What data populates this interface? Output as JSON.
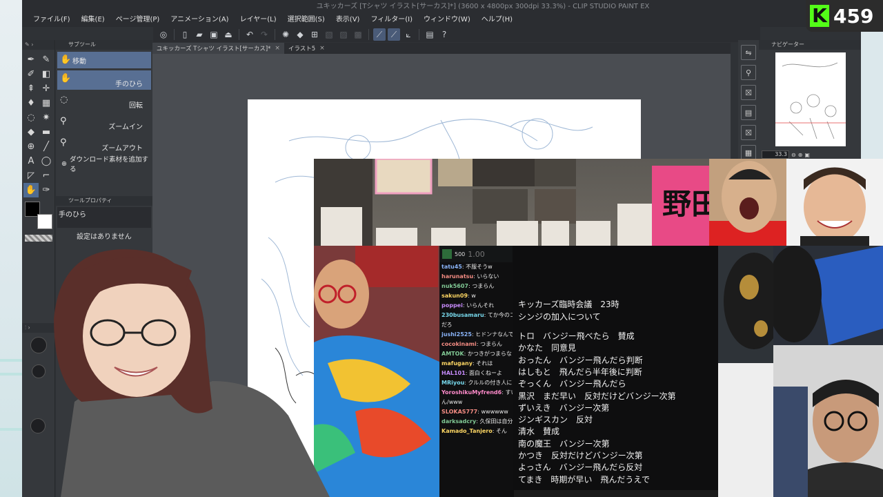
{
  "window": {
    "title": "ユキッカーズ [Tシャツ イラスト[サーカス]*] (3600 x 4800px 300dpi 33.3%) - CLIP STUDIO PAINT EX"
  },
  "menu": [
    "ファイル(F)",
    "編集(E)",
    "ページ管理(P)",
    "アニメーション(A)",
    "レイヤー(L)",
    "選択範囲(S)",
    "表示(V)",
    "フィルター(I)",
    "ウィンドウ(W)",
    "ヘルプ(H)"
  ],
  "subtool_panel": {
    "header": "サブツール",
    "items": [
      {
        "label": "移動",
        "position": "left",
        "selected": true
      },
      {
        "label": "手のひら",
        "position": "right",
        "selected": true
      },
      {
        "label": "回転",
        "position": "right"
      },
      {
        "label": "ズームイン",
        "position": "right"
      },
      {
        "label": "ズームアウト",
        "position": "right"
      }
    ],
    "add_material": "ダウンロード素材を追加する"
  },
  "tool_property": {
    "header": "ツールプロパティ",
    "tool_name": "手のひら",
    "no_settings": "設定はありません"
  },
  "doc_tabs": [
    {
      "label": "ユキッカーズ Tシャツ イラスト[サーカス]*",
      "active": true
    },
    {
      "label": "イラスト5",
      "active": false
    }
  ],
  "navigator": {
    "header": "ナビゲーター",
    "zoom": "33.3"
  },
  "chat": {
    "count": "500",
    "overlay_number": "1.00",
    "lines": [
      {
        "user": "tatu45",
        "text": "不服そうw"
      },
      {
        "user": "harunatsu",
        "text": "いらない"
      },
      {
        "user": "nuk5607",
        "text": "つまらん"
      },
      {
        "user": "sakun09",
        "text": "w"
      },
      {
        "user": "poppei",
        "text": "いらんそれ"
      },
      {
        "user": "230busamaru",
        "text": "てか今のコ"
      },
      {
        "user": "",
        "text": "だろ"
      },
      {
        "user": "jushi2525",
        "text": "ヒドンナなんで"
      },
      {
        "user": "cocokinami",
        "text": "つまらん"
      },
      {
        "user": "AMTOK",
        "text": "かつきがつまらな"
      },
      {
        "user": "mafugany",
        "text": "それは"
      },
      {
        "user": "HAL101",
        "text": "面白くねーよ"
      },
      {
        "user": "MRiyou",
        "text": "クルルの付き人に"
      },
      {
        "user": "YoroshikuMyfrend6",
        "text": "すい"
      },
      {
        "user": "",
        "text": "ん/www"
      },
      {
        "user": "SLOKAS777",
        "text": "wwwwww"
      },
      {
        "user": "darksadcry",
        "text": "久保田は自分"
      },
      {
        "user": "Kamado_Tanjero",
        "text": "そん"
      }
    ]
  },
  "agenda": {
    "title": "キッカーズ臨時会議　23時",
    "subtitle": "シンジの加入について",
    "votes": [
      "トロ　バンジー飛べたら　賛成",
      "かなた　同意見",
      "おったん　バンジー飛んだら判断",
      "はしもと　飛んだら半年後に判断",
      "ぞっくん　バンジー飛んだら",
      "黒沢　まだ早い　反対だけどバンジー次第",
      "ずいえき　バンジー次第",
      "ジンギスカン　反対",
      "清水　賛成",
      "南の魔王　バンジー次第",
      "かつき　反対だけどバンジー次第",
      "よっさん　バンジー飛んだら反対",
      "てまき　時期が早い　飛んだうえで"
    ]
  },
  "banner": {
    "text": "野田"
  },
  "badge": {
    "letter": "K",
    "count": "459",
    "color": "#53fc18"
  },
  "colors": {
    "main_color": "#000000",
    "sub_color": "#ffffff",
    "selection": "#586f93"
  }
}
